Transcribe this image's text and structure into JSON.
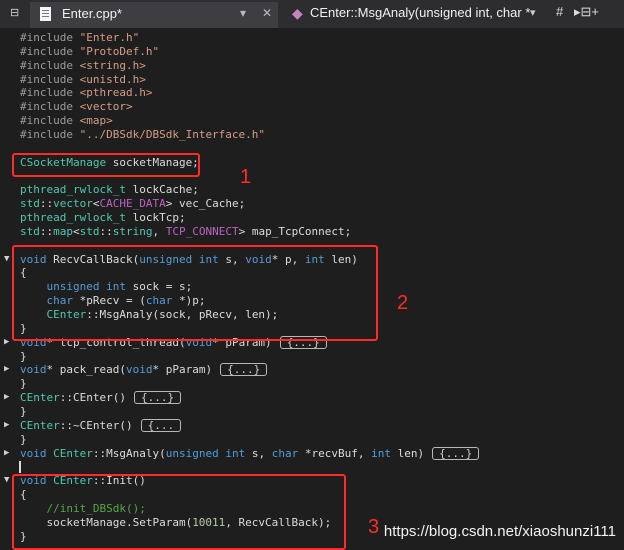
{
  "tabbar": {
    "pin_icon": "pin-icon",
    "close_icon": "close-icon",
    "file_tab_label": "Enter.cpp*",
    "tab_dropdown_glyph": "▾",
    "tab_close_glyph": "✕",
    "member_label": "CEnter::MsgAnaly(unsigned int, char *...",
    "member_dropdown_glyph": "▾",
    "hash_label": "#",
    "split_label": "▸⊟+"
  },
  "editor": {
    "lines": [
      {
        "segs": [
          [
            "pp",
            "#include "
          ],
          [
            "st",
            "\"Enter.h\""
          ]
        ]
      },
      {
        "segs": [
          [
            "pp",
            "#include "
          ],
          [
            "st",
            "\"ProtoDef.h\""
          ]
        ]
      },
      {
        "segs": [
          [
            "pp",
            "#include "
          ],
          [
            "st",
            "<string.h>"
          ]
        ]
      },
      {
        "segs": [
          [
            "pp",
            "#include "
          ],
          [
            "st",
            "<unistd.h>"
          ]
        ]
      },
      {
        "segs": [
          [
            "pp",
            "#include "
          ],
          [
            "st",
            "<pthread.h>"
          ]
        ]
      },
      {
        "segs": [
          [
            "pp",
            "#include "
          ],
          [
            "st",
            "<vector>"
          ]
        ]
      },
      {
        "segs": [
          [
            "pp",
            "#include "
          ],
          [
            "st",
            "<map>"
          ]
        ]
      },
      {
        "segs": [
          [
            "pp",
            "#include "
          ],
          [
            "st",
            "\"../DBSdk/DBSdk_Interface.h\""
          ]
        ]
      },
      {
        "segs": []
      },
      {
        "segs": [
          [
            "ty",
            "CSocketManage"
          ],
          [
            "t",
            " socketManage;"
          ]
        ]
      },
      {
        "segs": []
      },
      {
        "segs": [
          [
            "ty",
            "pthread_rwlock_t"
          ],
          [
            "t",
            " lockCache;"
          ]
        ]
      },
      {
        "segs": [
          [
            "ty",
            "std"
          ],
          [
            "t",
            "::"
          ],
          [
            "ty",
            "vector"
          ],
          [
            "t",
            "<"
          ],
          [
            "mc",
            "CACHE_DATA"
          ],
          [
            "t",
            "> vec_Cache;"
          ]
        ]
      },
      {
        "segs": [
          [
            "ty",
            "pthread_rwlock_t"
          ],
          [
            "t",
            " lockTcp;"
          ]
        ]
      },
      {
        "segs": [
          [
            "ty",
            "std"
          ],
          [
            "t",
            "::"
          ],
          [
            "ty",
            "map"
          ],
          [
            "t",
            "<"
          ],
          [
            "ty",
            "std"
          ],
          [
            "t",
            "::"
          ],
          [
            "ty",
            "string"
          ],
          [
            "t",
            ", "
          ],
          [
            "mc",
            "TCP_CONNECT"
          ],
          [
            "t",
            "> map_TcpConnect;"
          ]
        ]
      },
      {
        "segs": []
      },
      {
        "segs": [
          [
            "k",
            "void"
          ],
          [
            "t",
            " RecvCallBack("
          ],
          [
            "k",
            "unsigned int"
          ],
          [
            "t",
            " s, "
          ],
          [
            "k",
            "void"
          ],
          [
            "t",
            "* p, "
          ],
          [
            "k",
            "int"
          ],
          [
            "t",
            " len)"
          ]
        ]
      },
      {
        "segs": [
          [
            "t",
            "{"
          ]
        ]
      },
      {
        "segs": [
          [
            "t",
            "    "
          ],
          [
            "k",
            "unsigned int"
          ],
          [
            "t",
            " sock = s;"
          ]
        ]
      },
      {
        "segs": [
          [
            "t",
            "    "
          ],
          [
            "k",
            "char"
          ],
          [
            "t",
            " *pRecv = ("
          ],
          [
            "k",
            "char"
          ],
          [
            "t",
            " *)p;"
          ]
        ]
      },
      {
        "segs": [
          [
            "t",
            "    "
          ],
          [
            "ty",
            "CEnter"
          ],
          [
            "t",
            "::MsgAnaly(sock, pRecv, len);"
          ]
        ]
      },
      {
        "segs": [
          [
            "t",
            "}"
          ]
        ]
      },
      {
        "segs": [
          [
            "k",
            "void"
          ],
          [
            "t",
            "* tcp_control_thread("
          ],
          [
            "k",
            "void"
          ],
          [
            "t",
            "* pParam)"
          ]
        ],
        "collapsed": "{...}"
      },
      {
        "segs": [
          [
            "t",
            "}"
          ]
        ]
      },
      {
        "segs": [
          [
            "k",
            "void"
          ],
          [
            "t",
            "* pack_read("
          ],
          [
            "k",
            "void"
          ],
          [
            "t",
            "* pParam)"
          ]
        ],
        "collapsed": "{...}"
      },
      {
        "segs": [
          [
            "t",
            "}"
          ]
        ]
      },
      {
        "segs": [
          [
            "ty",
            "CEnter"
          ],
          [
            "t",
            "::CEnter()"
          ]
        ],
        "collapsed": "{...}"
      },
      {
        "segs": [
          [
            "t",
            "}"
          ]
        ]
      },
      {
        "segs": [
          [
            "ty",
            "CEnter"
          ],
          [
            "t",
            "::~CEnter()"
          ]
        ],
        "collapsed": "{..."
      },
      {
        "segs": [
          [
            "t",
            "}"
          ]
        ]
      },
      {
        "segs": [
          [
            "k",
            "void"
          ],
          [
            "t",
            " "
          ],
          [
            "ty",
            "CEnter"
          ],
          [
            "t",
            "::MsgAnaly("
          ],
          [
            "k",
            "unsigned int"
          ],
          [
            "t",
            " s, "
          ],
          [
            "k",
            "char"
          ],
          [
            "t",
            " *recvBuf, "
          ],
          [
            "k",
            "int"
          ],
          [
            "t",
            " len)"
          ]
        ],
        "collapsed": "{...}"
      },
      {
        "segs": []
      },
      {
        "segs": [
          [
            "k",
            "void"
          ],
          [
            "t",
            " "
          ],
          [
            "ty",
            "CEnter"
          ],
          [
            "t",
            "::Init()"
          ]
        ]
      },
      {
        "segs": [
          [
            "t",
            "{"
          ]
        ]
      },
      {
        "segs": [
          [
            "t",
            "    "
          ],
          [
            "cm",
            "//init_DBSdk();"
          ]
        ]
      },
      {
        "segs": [
          [
            "t",
            "    socketManage.SetParam("
          ],
          [
            "nm",
            "10011"
          ],
          [
            "t",
            ", RecvCallBack);"
          ]
        ]
      },
      {
        "segs": [
          [
            "t",
            "}"
          ]
        ]
      }
    ]
  },
  "annotations": [
    "1",
    "2",
    "3"
  ],
  "watermark": "https://blog.csdn.net/xiaoshunzi111",
  "colors": {
    "keyword": "#569cd6",
    "type": "#4ec9b0",
    "string": "#d69d85",
    "macro": "#bd63c5",
    "comment": "#57a64a",
    "highlight_box": "#ff2a2a"
  }
}
